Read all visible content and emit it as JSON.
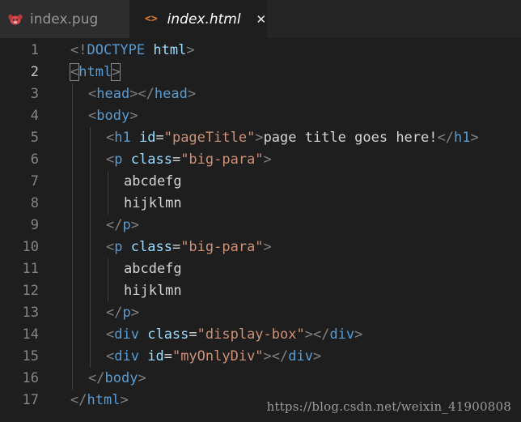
{
  "tabs": [
    {
      "label": "index.pug",
      "icon": "pug-icon",
      "active": false
    },
    {
      "label": "index.html",
      "icon": "html-icon",
      "active": true,
      "close_glyph": "✕"
    }
  ],
  "editor": {
    "active_line": 2,
    "lines": [
      {
        "n": "1",
        "indent": 0,
        "tokens": [
          [
            "br",
            "<!"
          ],
          [
            "tag",
            "DOCTYPE"
          ],
          [
            "txt",
            " "
          ],
          [
            "attr",
            "html"
          ],
          [
            "br",
            ">"
          ]
        ]
      },
      {
        "n": "2",
        "indent": 0,
        "tokens": [
          [
            "brhl",
            "<"
          ],
          [
            "tag",
            "html"
          ],
          [
            "brhl",
            ">"
          ]
        ]
      },
      {
        "n": "3",
        "indent": 1,
        "tokens": [
          [
            "br",
            "<"
          ],
          [
            "tag",
            "head"
          ],
          [
            "br",
            "></"
          ],
          [
            "tag",
            "head"
          ],
          [
            "br",
            ">"
          ]
        ]
      },
      {
        "n": "4",
        "indent": 1,
        "tokens": [
          [
            "br",
            "<"
          ],
          [
            "tag",
            "body"
          ],
          [
            "br",
            ">"
          ]
        ]
      },
      {
        "n": "5",
        "indent": 2,
        "tokens": [
          [
            "br",
            "<"
          ],
          [
            "tag",
            "h1"
          ],
          [
            "txt",
            " "
          ],
          [
            "attr",
            "id"
          ],
          [
            "eq",
            "="
          ],
          [
            "str",
            "\"pageTitle\""
          ],
          [
            "br",
            ">"
          ],
          [
            "txt",
            "page title goes here!"
          ],
          [
            "br",
            "</"
          ],
          [
            "tag",
            "h1"
          ],
          [
            "br",
            ">"
          ]
        ]
      },
      {
        "n": "6",
        "indent": 2,
        "tokens": [
          [
            "br",
            "<"
          ],
          [
            "tag",
            "p"
          ],
          [
            "txt",
            " "
          ],
          [
            "attr",
            "class"
          ],
          [
            "eq",
            "="
          ],
          [
            "str",
            "\"big-para\""
          ],
          [
            "br",
            ">"
          ]
        ]
      },
      {
        "n": "7",
        "indent": 3,
        "tokens": [
          [
            "txt",
            "abcdefg"
          ]
        ]
      },
      {
        "n": "8",
        "indent": 3,
        "tokens": [
          [
            "txt",
            "hijklmn"
          ]
        ]
      },
      {
        "n": "9",
        "indent": 2,
        "tokens": [
          [
            "br",
            "</"
          ],
          [
            "tag",
            "p"
          ],
          [
            "br",
            ">"
          ]
        ]
      },
      {
        "n": "10",
        "indent": 2,
        "tokens": [
          [
            "br",
            "<"
          ],
          [
            "tag",
            "p"
          ],
          [
            "txt",
            " "
          ],
          [
            "attr",
            "class"
          ],
          [
            "eq",
            "="
          ],
          [
            "str",
            "\"big-para\""
          ],
          [
            "br",
            ">"
          ]
        ]
      },
      {
        "n": "11",
        "indent": 3,
        "tokens": [
          [
            "txt",
            "abcdefg"
          ]
        ]
      },
      {
        "n": "12",
        "indent": 3,
        "tokens": [
          [
            "txt",
            "hijklmn"
          ]
        ]
      },
      {
        "n": "13",
        "indent": 2,
        "tokens": [
          [
            "br",
            "</"
          ],
          [
            "tag",
            "p"
          ],
          [
            "br",
            ">"
          ]
        ]
      },
      {
        "n": "14",
        "indent": 2,
        "tokens": [
          [
            "br",
            "<"
          ],
          [
            "tag",
            "div"
          ],
          [
            "txt",
            " "
          ],
          [
            "attr",
            "class"
          ],
          [
            "eq",
            "="
          ],
          [
            "str",
            "\"display-box\""
          ],
          [
            "br",
            "></"
          ],
          [
            "tag",
            "div"
          ],
          [
            "br",
            ">"
          ]
        ]
      },
      {
        "n": "15",
        "indent": 2,
        "tokens": [
          [
            "br",
            "<"
          ],
          [
            "tag",
            "div"
          ],
          [
            "txt",
            " "
          ],
          [
            "attr",
            "id"
          ],
          [
            "eq",
            "="
          ],
          [
            "str",
            "\"myOnlyDiv\""
          ],
          [
            "br",
            "></"
          ],
          [
            "tag",
            "div"
          ],
          [
            "br",
            ">"
          ]
        ]
      },
      {
        "n": "16",
        "indent": 1,
        "tokens": [
          [
            "br",
            "</"
          ],
          [
            "tag",
            "body"
          ],
          [
            "br",
            ">"
          ]
        ]
      },
      {
        "n": "17",
        "indent": 0,
        "tokens": [
          [
            "br",
            "</"
          ],
          [
            "tag",
            "html"
          ],
          [
            "br",
            ">"
          ]
        ]
      }
    ]
  },
  "watermark": "https://blog.csdn.net/weixin_41900808",
  "colors": {
    "background": "#1e1e1e",
    "tag": "#569cd6",
    "attribute": "#9cdcfe",
    "string": "#ce9178",
    "punctuation": "#808080",
    "html_icon": "#e37933",
    "pug_icon": "#d3484c"
  }
}
